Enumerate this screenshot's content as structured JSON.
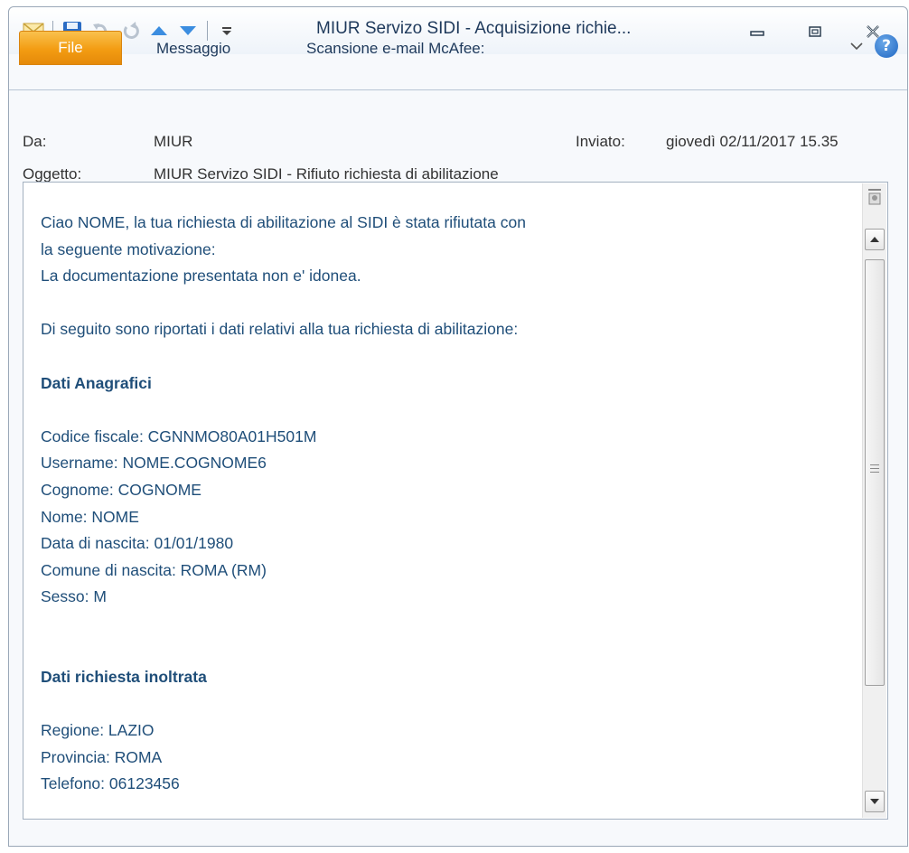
{
  "window": {
    "title": "MIUR Servizo SIDI - Acquisizione richie..."
  },
  "tabs": {
    "file": "File",
    "messaggio": "Messaggio",
    "mcafee": "Scansione e-mail McAfee:"
  },
  "header": {
    "from_label": "Da:",
    "from_value": "MIUR",
    "sent_label": "Inviato:",
    "sent_value": "giovedì 02/11/2017 15.35",
    "subject_label": "Oggetto:",
    "subject_value": "MIUR Servizo SIDI - Rifiuto richiesta di abilitazione"
  },
  "body": {
    "lines": [
      "Ciao NOME, la tua richiesta di abilitazione al SIDI è stata rifiutata con",
      "la seguente motivazione:",
      "La documentazione presentata non e' idonea.",
      "",
      "Di seguito sono riportati i dati relativi alla tua richiesta di abilitazione:",
      "",
      "Dati Anagrafici",
      "",
      "Codice fiscale: CGNNMO80A01H501M",
      "Username: NOME.COGNOME6",
      "Cognome: COGNOME",
      "Nome: NOME",
      "Data di nascita: 01/01/1980",
      "Comune di nascita: ROMA (RM)",
      "Sesso: M",
      "",
      "",
      "Dati richiesta inoltrata",
      "",
      "Regione: LAZIO",
      "Provincia: ROMA",
      "Telefono: 06123456"
    ]
  },
  "colors": {
    "body_text": "#1f4e79",
    "file_tab": "#f39c12",
    "title_text": "#1e395b"
  }
}
